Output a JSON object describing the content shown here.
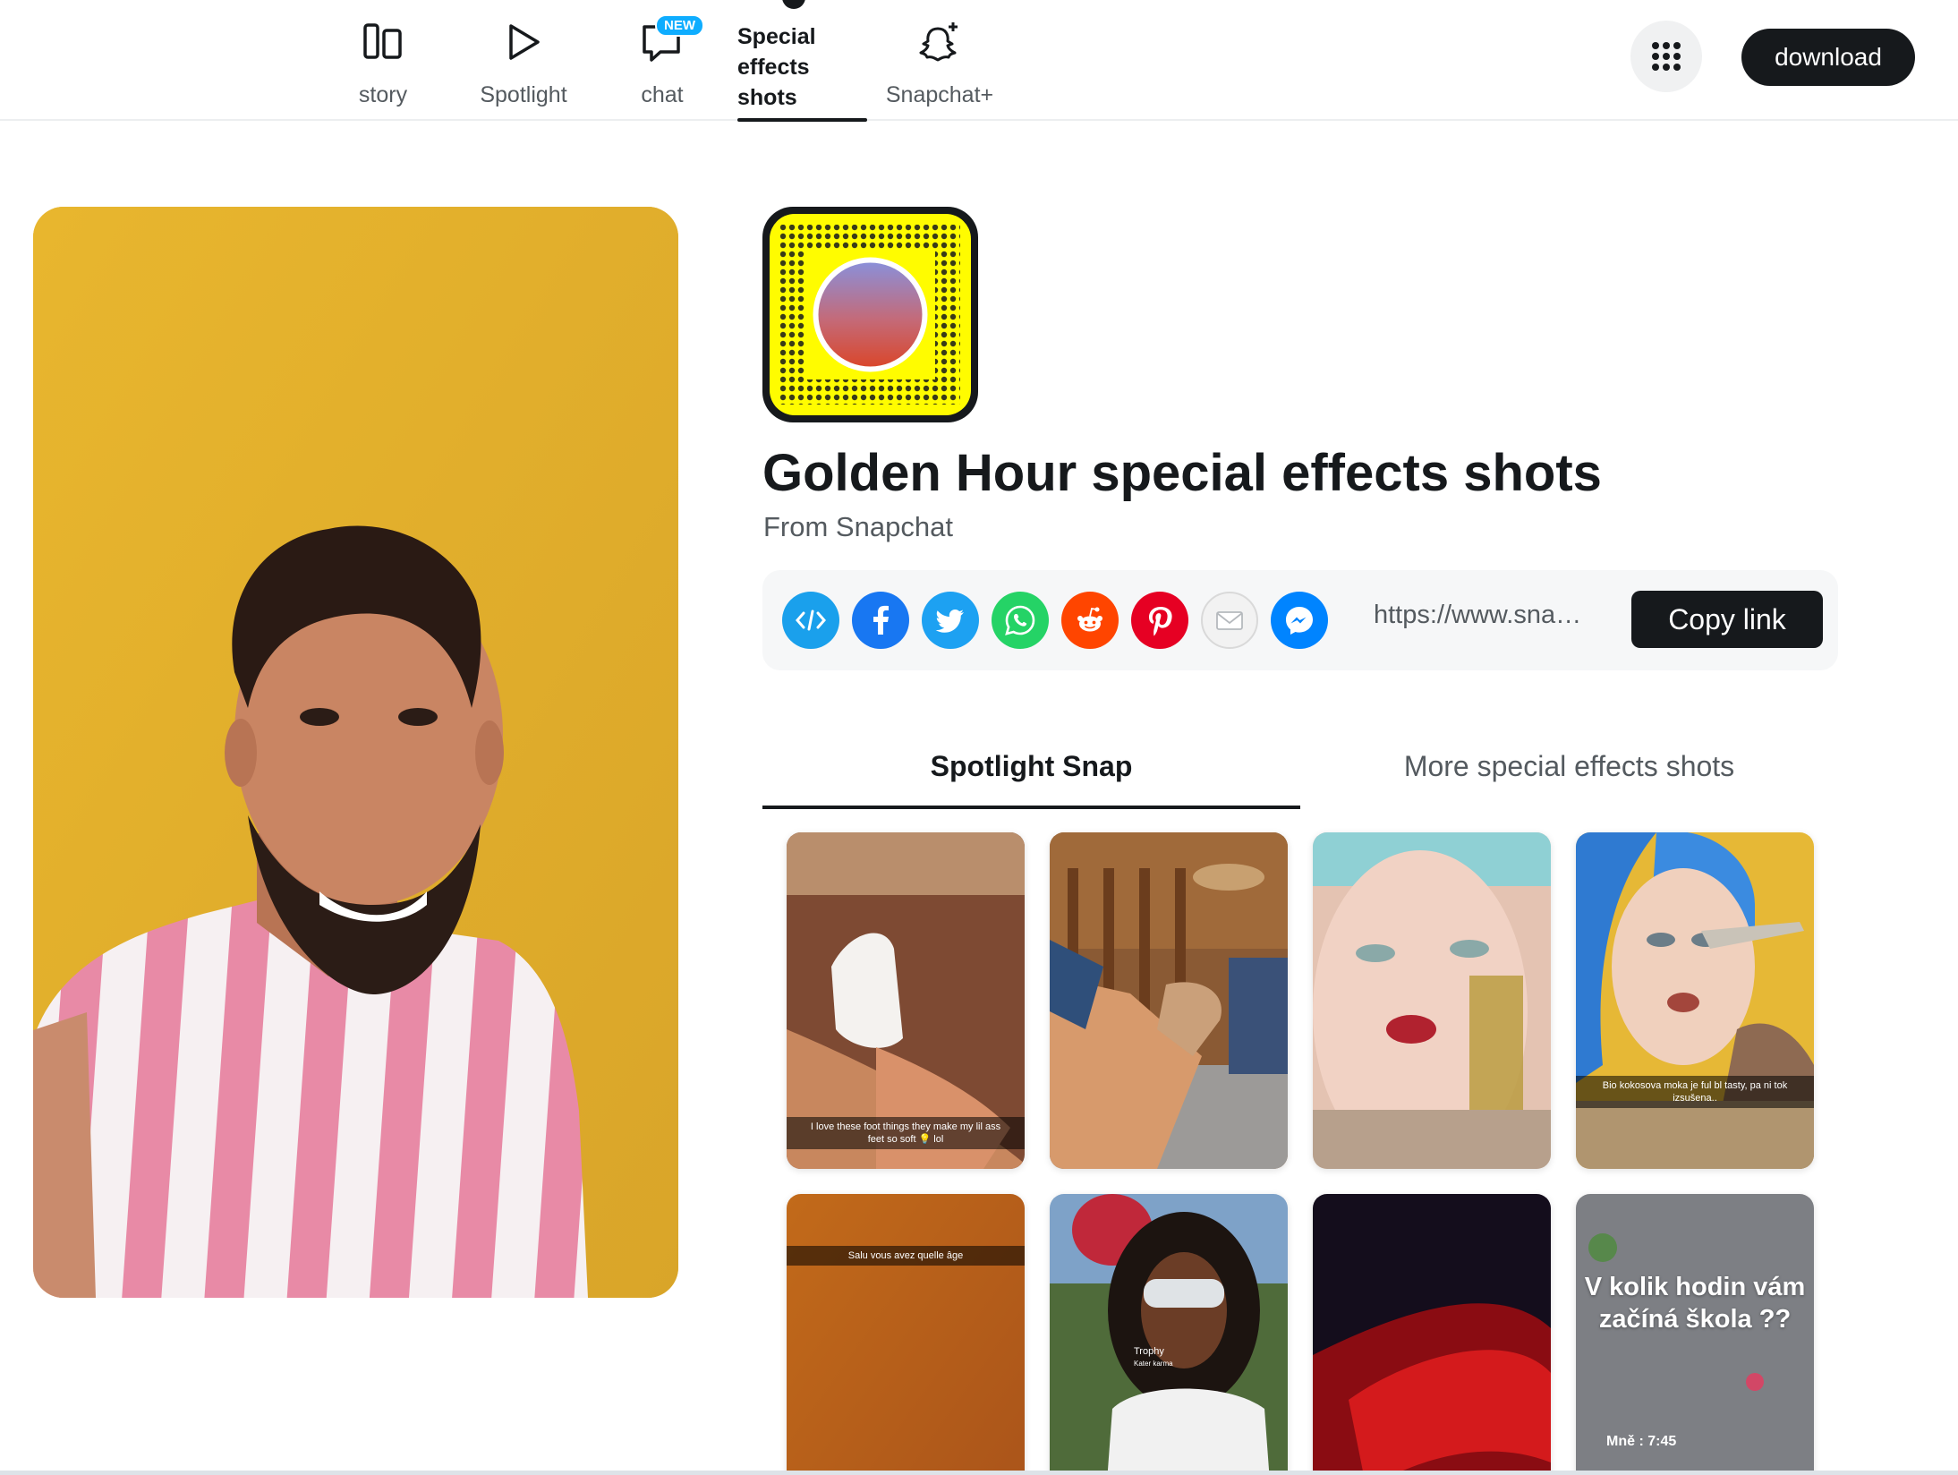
{
  "nav": {
    "items": [
      {
        "label": "story",
        "icon": "stories-icon"
      },
      {
        "label": "Spotlight",
        "icon": "spotlight-play-icon"
      },
      {
        "label": "chat",
        "icon": "chat-icon",
        "badge": "NEW"
      },
      {
        "label_lines": [
          "Special",
          "effects",
          "shots"
        ],
        "icon": "lenses-icon",
        "active": true
      },
      {
        "label": "Snapchat+",
        "icon": "snapchat-plus-ghost-icon"
      }
    ],
    "apps_icon": "apps-grid-icon",
    "download_label": "download"
  },
  "lens": {
    "title": "Golden Hour special effects shots",
    "creator": "From Snapchat",
    "snapcode_icon": "snapcode-icon"
  },
  "share": {
    "icons": [
      "embed-icon",
      "facebook-icon",
      "twitter-icon",
      "whatsapp-icon",
      "reddit-icon",
      "pinterest-icon",
      "email-icon",
      "messenger-icon"
    ],
    "url": "https://www.snapc...",
    "copy_label": "Copy link"
  },
  "tabs": {
    "spotlight": "Spotlight Snap",
    "more": "More special effects shots",
    "active": "spotlight"
  },
  "thumbnails": [
    {
      "caption": "I love these foot things they make my lil ass feet so soft 💡 lol"
    },
    {
      "caption": ""
    },
    {
      "caption": ""
    },
    {
      "caption": "Bio kokosova moka je ful bl tasty, pa ni tok izsušena.."
    },
    {
      "caption": "Salu vous avez quelle âge"
    },
    {
      "caption": "Trophy",
      "subcaption": "Kater karma"
    },
    {
      "caption": ""
    },
    {
      "caption": "V kolik hodin vám začíná škola ??",
      "time": "Mně : 7:45"
    }
  ],
  "colors": {
    "accent": "#16191c",
    "snap_yellow": "#fffc00",
    "new_badge": "#0fadff",
    "facebook": "#1877f2",
    "twitter": "#1da1f2",
    "whatsapp": "#25d366",
    "reddit": "#ff4500",
    "pinterest": "#e60023",
    "messenger": "#0084ff"
  }
}
